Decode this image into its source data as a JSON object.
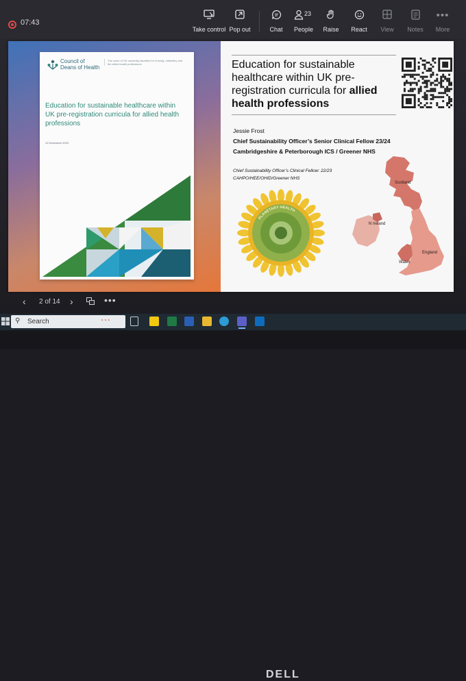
{
  "meeting": {
    "recording_time": "07:43",
    "toolbar": [
      {
        "id": "take-control",
        "label": "Take control",
        "icon": "monitor-cursor-icon"
      },
      {
        "id": "pop-out",
        "label": "Pop out",
        "icon": "pop-out-icon"
      },
      {
        "id": "chat",
        "label": "Chat",
        "icon": "chat-icon"
      },
      {
        "id": "people",
        "label": "People",
        "icon": "people-icon",
        "count": "23"
      },
      {
        "id": "raise",
        "label": "Raise",
        "icon": "raise-hand-icon"
      },
      {
        "id": "react",
        "label": "React",
        "icon": "smiley-icon"
      },
      {
        "id": "view",
        "label": "View",
        "icon": "grid-view-icon"
      },
      {
        "id": "notes",
        "label": "Notes",
        "icon": "notes-icon"
      },
      {
        "id": "more",
        "label": "More",
        "icon": "more-icon"
      }
    ]
  },
  "slide": {
    "cover": {
      "org_name": "Council of Deans of Health",
      "org_tagline": "The voice of UK university faculties for nursing, midwifery and the allied health professions",
      "title": "Education for sustainable healthcare within UK pre-registration curricula for allied health professions",
      "date": "12 December 2023"
    },
    "title_normal": "Education for sustainable healthcare within UK pre-registration curricula for ",
    "title_bold": "allied health professions",
    "presenter_name": "Jessie Frost",
    "presenter_role_1": "Chief Sustainability Officer’s Senior Clinical Fellow 23/24",
    "presenter_role_2": "Cambridgeshire & Peterborough ICS / Greener NHS",
    "fellow_line_1": "Chief Sustainability Officer’s Clinical Fellow: 22/23",
    "fellow_line_2": "CAHPO/HEE/OHID/Greener NHS",
    "sun_label": "PLANETARY HEALTH",
    "map_labels": {
      "scotland": "Scotland",
      "ni": "N Ireland",
      "wales": "Wales",
      "england": "England"
    }
  },
  "slide_nav": {
    "page": "2 of 14",
    "more": "•••"
  },
  "taskbar": {
    "search_label": "Search",
    "apps": [
      "task-view-icon",
      "sticky-notes-icon",
      "excel-icon",
      "word-icon",
      "file-explorer-icon",
      "edge-icon",
      "teams-icon",
      "outlook-icon"
    ]
  },
  "brand": "DELL"
}
